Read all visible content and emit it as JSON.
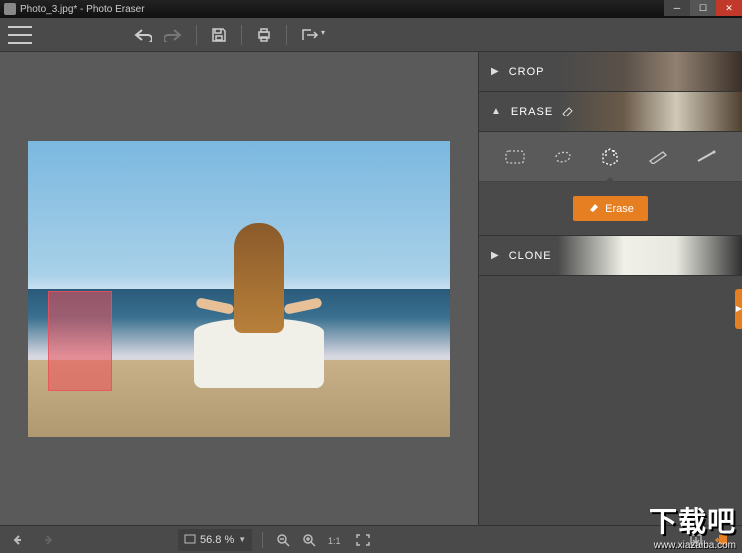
{
  "window": {
    "title": "Photo_3.jpg* - Photo Eraser"
  },
  "toolbar": {
    "menu_label": "Menu",
    "undo": "Undo",
    "redo": "Redo",
    "save": "Save",
    "print": "Print",
    "export": "Export"
  },
  "panels": {
    "crop": {
      "label": "CROP"
    },
    "erase": {
      "label": "ERASE",
      "tools": {
        "rect": "Rectangle selection",
        "lasso": "Lasso selection",
        "polygon": "Polygon selection",
        "brush": "Brush selection",
        "magic": "Magic wand"
      },
      "erase_button": "Erase"
    },
    "clone": {
      "label": "CLONE"
    }
  },
  "statusbar": {
    "zoom_value": "56.8 %",
    "zoom_out": "Zoom out",
    "zoom_in": "Zoom in",
    "fit": "Fit to screen",
    "actual": "Actual size",
    "save_state": "Save",
    "exit": "Exit"
  },
  "watermark": {
    "text": "下载吧",
    "url": "www.xiazaiba.com"
  },
  "colors": {
    "accent": "#e67e22",
    "panel": "#4a4a4a"
  }
}
